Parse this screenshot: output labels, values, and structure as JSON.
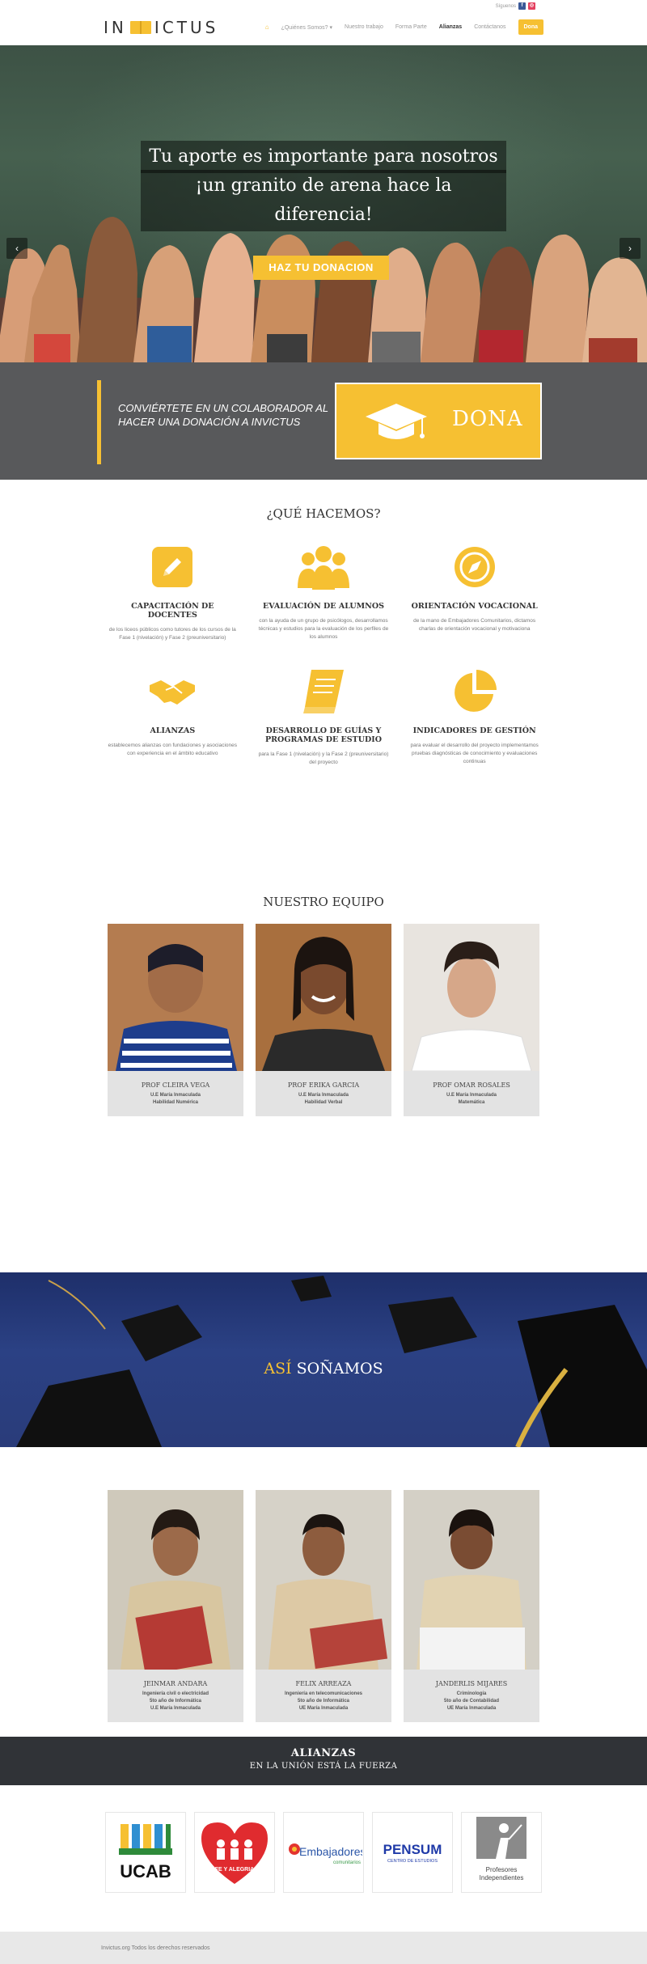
{
  "header": {
    "social_label": "Síguenos",
    "logo_left": "IN",
    "logo_right": "ICTUS",
    "nav": [
      {
        "label": "¿Quiénes Somos? ▾"
      },
      {
        "label": "Nuestro trabajo"
      },
      {
        "label": "Forma Parte"
      },
      {
        "label": "Alianzas"
      },
      {
        "label": "Contáctanos"
      }
    ],
    "dona_label": "Dona",
    "colors": {
      "accent": "#f6c032",
      "dark": "#303337"
    }
  },
  "hero": {
    "line1": "Tu aporte es importante para nosotros",
    "line2": "¡un granito de arena hace la diferencia!",
    "cta": "HAZ TU DONACION",
    "prev": "‹",
    "next": "›"
  },
  "donate": {
    "text": "CONVIÉRTETE EN UN COLABORADOR AL HACER UNA DONACIÓN A INVICTUS",
    "button": "DONA"
  },
  "what": {
    "title": "¿QUÉ HACEMOS?",
    "items": [
      {
        "icon": "pencil-icon",
        "title": "CAPACITACIÓN DE DOCENTES",
        "text": "de los liceos públicos como tutores de los cursos de la Fase 1 (nivelación) y Fase 2 (preuniversitario)"
      },
      {
        "icon": "group-icon",
        "title": "EVALUACIÓN DE ALUMNOS",
        "text": "con la ayuda de un grupo de psicólogos, desarrollamos técnicas y estudios para la evaluación de los perfiles de los alumnos"
      },
      {
        "icon": "compass-icon",
        "title": "ORIENTACIÓN VOCACIONAL",
        "text": "de la mano de Embajadores Comunitarios, dictamos charlas de orientación vocacional y motivaciona"
      },
      {
        "icon": "handshake-icon",
        "title": "ALIANZAS",
        "text": "establecemos alianzas con fundaciones y asociaciones con experiencia en el ámbito educativo"
      },
      {
        "icon": "book-icon",
        "title": "DESARROLLO DE GUÍAS Y PROGRAMAS DE ESTUDIO",
        "text": "para la Fase 1 (nivelación) y la Fase 2 (preuniversitario) del proyecto"
      },
      {
        "icon": "pie-chart-icon",
        "title": "INDICADORES DE GESTIÓN",
        "text": "para evaluar el desarrollo del proyecto implementamos pruebas diagnósticas de conocimiento y evaluaciones continuas"
      }
    ]
  },
  "team": {
    "title": "NUESTRO EQUIPO",
    "members": [
      {
        "name": "PROF CLEIRA VEGA",
        "l1": "U.E María Inmaculada",
        "l2": "Habilidad Numérica",
        "l3": ""
      },
      {
        "name": "PROF ERIKA GARCIA",
        "l1": "U.E María Inmaculada",
        "l2": "Habilidad Verbal",
        "l3": ""
      },
      {
        "name": "PROF OMAR ROSALES",
        "l1": "U.E María Inmaculada",
        "l2": "Matemática",
        "l3": ""
      }
    ]
  },
  "banner": {
    "highlight": "ASÍ",
    "rest": " SOÑAMOS"
  },
  "students": {
    "members": [
      {
        "name": "JEINMAR ANDARA",
        "l1": "Ingeniería civil o electricidad",
        "l2": "5to año de Informática",
        "l3": "U.E María Inmaculada"
      },
      {
        "name": "FELIX ARREAZA",
        "l1": "Ingeniería en telecomunicaciones",
        "l2": "5to año de Informática",
        "l3": "UE María Inmaculada"
      },
      {
        "name": "JANDERLIS MIJARES",
        "l1": "Criminología",
        "l2": "5to año de Contabilidad",
        "l3": "UE María Inmaculada"
      }
    ]
  },
  "alianzas": {
    "title": "ALIANZAS",
    "subtitle": "EN LA UNIÓN ESTÁ LA FUERZA",
    "partners": [
      {
        "name": "UCAB"
      },
      {
        "name": "FE Y ALEGRIA"
      },
      {
        "name": "Embajadores",
        "sub": "comunitarios"
      },
      {
        "name": "PENSUM",
        "sub": "CENTRO DE ESTUDIOS"
      },
      {
        "name": "Profesores",
        "sub": "Independientes"
      }
    ]
  },
  "footer": {
    "text": "Invictus.org Todos los derechos reservados"
  }
}
